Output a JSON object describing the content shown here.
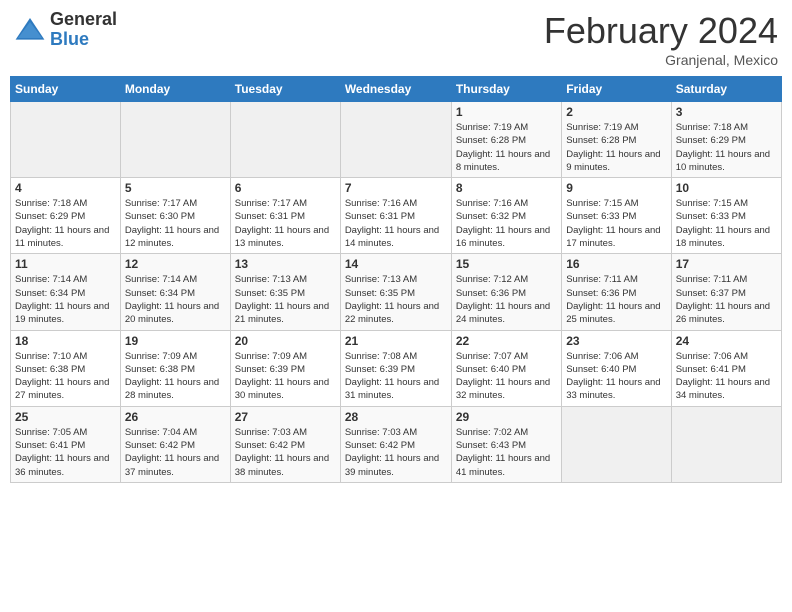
{
  "header": {
    "logo": {
      "general": "General",
      "blue": "Blue"
    },
    "title": "February 2024",
    "location": "Granjenal, Mexico"
  },
  "days_of_week": [
    "Sunday",
    "Monday",
    "Tuesday",
    "Wednesday",
    "Thursday",
    "Friday",
    "Saturday"
  ],
  "weeks": [
    [
      {
        "day": "",
        "info": ""
      },
      {
        "day": "",
        "info": ""
      },
      {
        "day": "",
        "info": ""
      },
      {
        "day": "",
        "info": ""
      },
      {
        "day": "1",
        "info": "Sunrise: 7:19 AM\nSunset: 6:28 PM\nDaylight: 11 hours and 8 minutes."
      },
      {
        "day": "2",
        "info": "Sunrise: 7:19 AM\nSunset: 6:28 PM\nDaylight: 11 hours and 9 minutes."
      },
      {
        "day": "3",
        "info": "Sunrise: 7:18 AM\nSunset: 6:29 PM\nDaylight: 11 hours and 10 minutes."
      }
    ],
    [
      {
        "day": "4",
        "info": "Sunrise: 7:18 AM\nSunset: 6:29 PM\nDaylight: 11 hours and 11 minutes."
      },
      {
        "day": "5",
        "info": "Sunrise: 7:17 AM\nSunset: 6:30 PM\nDaylight: 11 hours and 12 minutes."
      },
      {
        "day": "6",
        "info": "Sunrise: 7:17 AM\nSunset: 6:31 PM\nDaylight: 11 hours and 13 minutes."
      },
      {
        "day": "7",
        "info": "Sunrise: 7:16 AM\nSunset: 6:31 PM\nDaylight: 11 hours and 14 minutes."
      },
      {
        "day": "8",
        "info": "Sunrise: 7:16 AM\nSunset: 6:32 PM\nDaylight: 11 hours and 16 minutes."
      },
      {
        "day": "9",
        "info": "Sunrise: 7:15 AM\nSunset: 6:33 PM\nDaylight: 11 hours and 17 minutes."
      },
      {
        "day": "10",
        "info": "Sunrise: 7:15 AM\nSunset: 6:33 PM\nDaylight: 11 hours and 18 minutes."
      }
    ],
    [
      {
        "day": "11",
        "info": "Sunrise: 7:14 AM\nSunset: 6:34 PM\nDaylight: 11 hours and 19 minutes."
      },
      {
        "day": "12",
        "info": "Sunrise: 7:14 AM\nSunset: 6:34 PM\nDaylight: 11 hours and 20 minutes."
      },
      {
        "day": "13",
        "info": "Sunrise: 7:13 AM\nSunset: 6:35 PM\nDaylight: 11 hours and 21 minutes."
      },
      {
        "day": "14",
        "info": "Sunrise: 7:13 AM\nSunset: 6:35 PM\nDaylight: 11 hours and 22 minutes."
      },
      {
        "day": "15",
        "info": "Sunrise: 7:12 AM\nSunset: 6:36 PM\nDaylight: 11 hours and 24 minutes."
      },
      {
        "day": "16",
        "info": "Sunrise: 7:11 AM\nSunset: 6:36 PM\nDaylight: 11 hours and 25 minutes."
      },
      {
        "day": "17",
        "info": "Sunrise: 7:11 AM\nSunset: 6:37 PM\nDaylight: 11 hours and 26 minutes."
      }
    ],
    [
      {
        "day": "18",
        "info": "Sunrise: 7:10 AM\nSunset: 6:38 PM\nDaylight: 11 hours and 27 minutes."
      },
      {
        "day": "19",
        "info": "Sunrise: 7:09 AM\nSunset: 6:38 PM\nDaylight: 11 hours and 28 minutes."
      },
      {
        "day": "20",
        "info": "Sunrise: 7:09 AM\nSunset: 6:39 PM\nDaylight: 11 hours and 30 minutes."
      },
      {
        "day": "21",
        "info": "Sunrise: 7:08 AM\nSunset: 6:39 PM\nDaylight: 11 hours and 31 minutes."
      },
      {
        "day": "22",
        "info": "Sunrise: 7:07 AM\nSunset: 6:40 PM\nDaylight: 11 hours and 32 minutes."
      },
      {
        "day": "23",
        "info": "Sunrise: 7:06 AM\nSunset: 6:40 PM\nDaylight: 11 hours and 33 minutes."
      },
      {
        "day": "24",
        "info": "Sunrise: 7:06 AM\nSunset: 6:41 PM\nDaylight: 11 hours and 34 minutes."
      }
    ],
    [
      {
        "day": "25",
        "info": "Sunrise: 7:05 AM\nSunset: 6:41 PM\nDaylight: 11 hours and 36 minutes."
      },
      {
        "day": "26",
        "info": "Sunrise: 7:04 AM\nSunset: 6:42 PM\nDaylight: 11 hours and 37 minutes."
      },
      {
        "day": "27",
        "info": "Sunrise: 7:03 AM\nSunset: 6:42 PM\nDaylight: 11 hours and 38 minutes."
      },
      {
        "day": "28",
        "info": "Sunrise: 7:03 AM\nSunset: 6:42 PM\nDaylight: 11 hours and 39 minutes."
      },
      {
        "day": "29",
        "info": "Sunrise: 7:02 AM\nSunset: 6:43 PM\nDaylight: 11 hours and 41 minutes."
      },
      {
        "day": "",
        "info": ""
      },
      {
        "day": "",
        "info": ""
      }
    ]
  ]
}
